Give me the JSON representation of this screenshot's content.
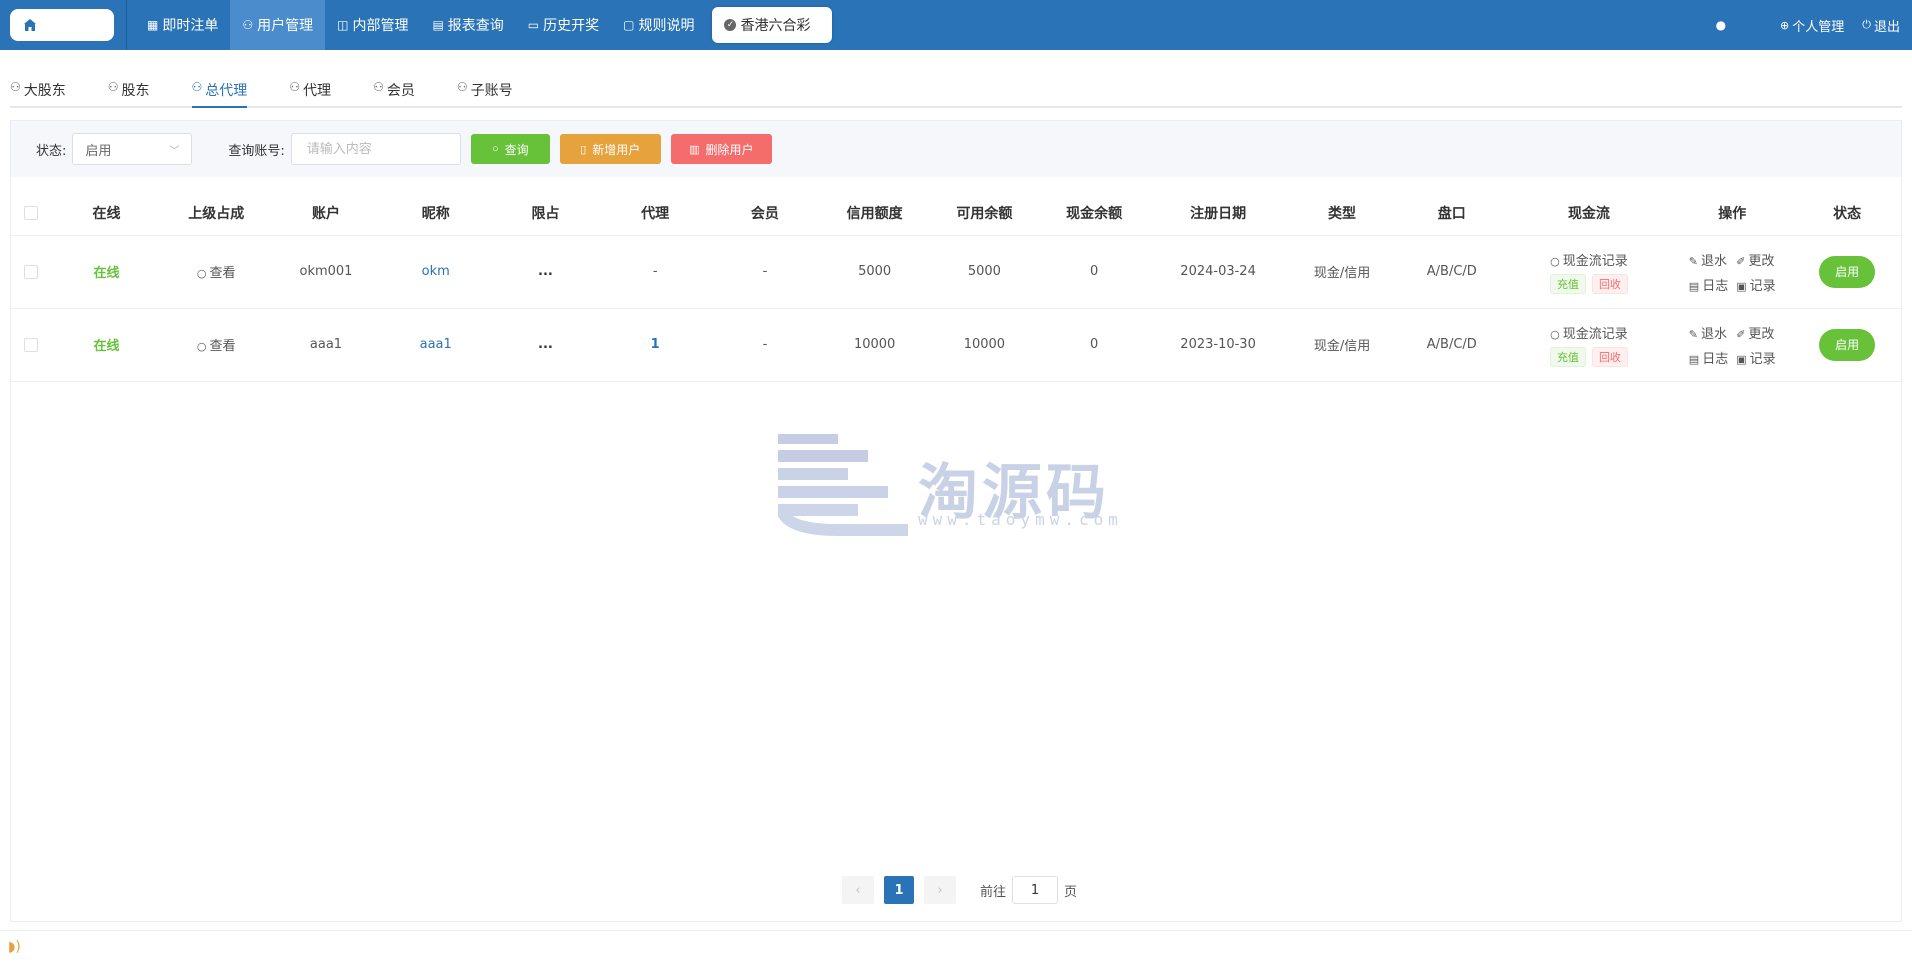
{
  "header": {
    "nav": [
      {
        "icon": "grid-icon",
        "label": "即时注单",
        "active": false
      },
      {
        "icon": "user-icon",
        "label": "用户管理",
        "active": true
      },
      {
        "icon": "layout-icon",
        "label": "内部管理",
        "active": false
      },
      {
        "icon": "report-icon",
        "label": "报表查询",
        "active": false
      },
      {
        "icon": "monitor-icon",
        "label": "历史开奖",
        "active": false
      },
      {
        "icon": "message-icon",
        "label": "规则说明",
        "active": false
      }
    ],
    "game": "香港六合彩",
    "personal": "个人管理",
    "logout": "退出"
  },
  "subtabs": [
    {
      "label": "大股东",
      "active": false
    },
    {
      "label": "股东",
      "active": false
    },
    {
      "label": "总代理",
      "active": true
    },
    {
      "label": "代理",
      "active": false
    },
    {
      "label": "会员",
      "active": false
    },
    {
      "label": "子账号",
      "active": false
    }
  ],
  "filter": {
    "status_label": "状态:",
    "status_value": "启用",
    "account_label": "查询账号:",
    "account_placeholder": "请输入内容",
    "search_btn": "查询",
    "add_btn": "新增用户",
    "delete_btn": "删除用户"
  },
  "table": {
    "columns": [
      "在线",
      "上级占成",
      "账户",
      "昵称",
      "限占",
      "代理",
      "会员",
      "信用额度",
      "可用余额",
      "现金余额",
      "注册日期",
      "类型",
      "盘口",
      "现金流",
      "操作",
      "状态"
    ],
    "rows": [
      {
        "online": "在线",
        "view": "查看",
        "account": "okm001",
        "nickname": "okm",
        "limit": "...",
        "agent": "-",
        "member": "-",
        "credit": "5000",
        "available": "5000",
        "cash": "0",
        "date": "2024-03-24",
        "type": "现金/信用",
        "handicap": "A/B/C/D",
        "status": "启用"
      },
      {
        "online": "在线",
        "view": "查看",
        "account": "aaa1",
        "nickname": "aaa1",
        "limit": "...",
        "agent": "1",
        "member": "-",
        "credit": "10000",
        "available": "10000",
        "cash": "0",
        "date": "2023-10-30",
        "type": "现金/信用",
        "handicap": "A/B/C/D",
        "status": "启用"
      }
    ],
    "cashflow": {
      "record": "现金流记录",
      "recharge": "充值",
      "recall": "回收"
    },
    "ops": {
      "rebate": "退水",
      "edit": "更改",
      "log": "日志",
      "record": "记录"
    }
  },
  "pagination": {
    "current": "1",
    "goto_prefix": "前往",
    "goto_value": "1",
    "goto_suffix": "页"
  },
  "watermark": {
    "logo_text": "淘源码",
    "logo_url": "www.taoymw.com"
  },
  "colors": {
    "primary": "#2a73b6",
    "success": "#67c23a",
    "warning": "#e6a23c",
    "danger": "#f56c6c"
  }
}
